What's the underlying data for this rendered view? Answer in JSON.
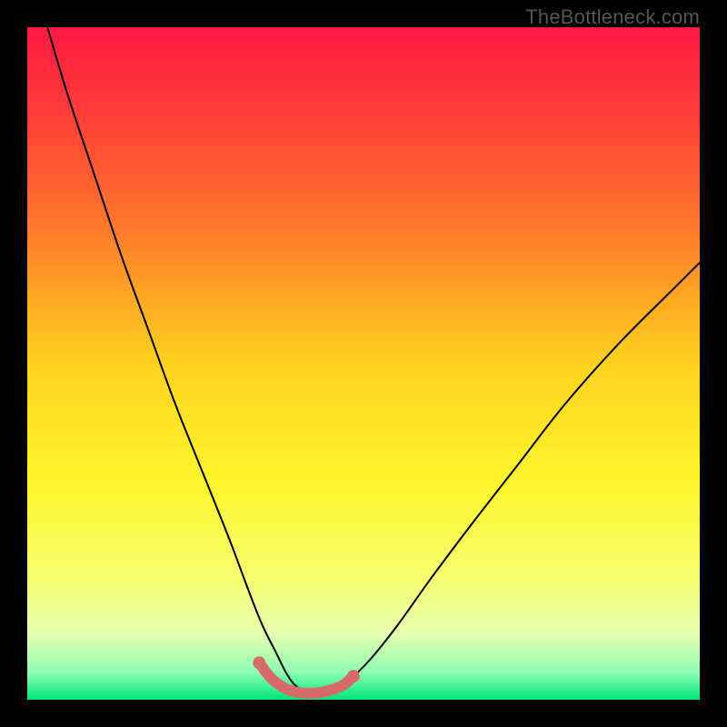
{
  "watermark": "TheBottleneck.com",
  "chart_data": {
    "type": "line",
    "title": "",
    "xlabel": "",
    "ylabel": "",
    "xlim": [
      0,
      100
    ],
    "ylim": [
      0,
      100
    ],
    "gradient_stops": [
      {
        "offset": 0.0,
        "color": "#ff1a44"
      },
      {
        "offset": 0.12,
        "color": "#ff3a3a"
      },
      {
        "offset": 0.3,
        "color": "#ff7a2a"
      },
      {
        "offset": 0.5,
        "color": "#ffd21f"
      },
      {
        "offset": 0.68,
        "color": "#fff62e"
      },
      {
        "offset": 0.82,
        "color": "#f6ff70"
      },
      {
        "offset": 0.9,
        "color": "#e8ffb0"
      },
      {
        "offset": 0.96,
        "color": "#8cffb0"
      },
      {
        "offset": 1.0,
        "color": "#00e47a"
      }
    ],
    "series": [
      {
        "name": "curve",
        "color": "#000000",
        "width": 2,
        "x": [
          3,
          6,
          10,
          14,
          18,
          22,
          26,
          30,
          33,
          35,
          37,
          38.5,
          40,
          42,
          44,
          46,
          48,
          51,
          55,
          60,
          66,
          73,
          80,
          88,
          96,
          100
        ],
        "y": [
          100,
          90,
          78,
          66,
          55,
          44,
          34,
          24,
          16,
          11,
          7,
          4,
          2,
          1,
          1,
          1.5,
          3,
          6,
          11,
          18,
          26,
          35,
          44,
          53,
          61,
          65
        ]
      },
      {
        "name": "highlight",
        "color": "#d96a6a",
        "width": 12,
        "linecap": "round",
        "x": [
          34.5,
          36,
          37.5,
          39,
          41,
          43,
          45,
          47,
          48.5
        ],
        "y": [
          5.5,
          3.5,
          2.2,
          1.4,
          1.0,
          1.0,
          1.4,
          2.2,
          3.5
        ]
      }
    ]
  }
}
